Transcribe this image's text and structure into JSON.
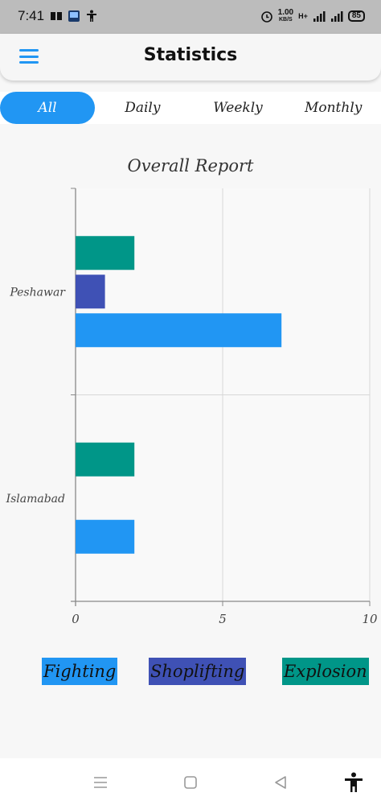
{
  "status_bar": {
    "time": "7:41",
    "net_speed_value": "1.00",
    "net_speed_unit": "KB/S",
    "network_type": "H+",
    "battery": "85"
  },
  "app_bar": {
    "title": "Statistics"
  },
  "tabs": [
    {
      "label": "All",
      "active": true
    },
    {
      "label": "Daily",
      "active": false
    },
    {
      "label": "Weekly",
      "active": false
    },
    {
      "label": "Monthly",
      "active": false
    }
  ],
  "chart_data": {
    "type": "bar",
    "orientation": "horizontal",
    "title": "Overall Report",
    "categories": [
      "Peshawar",
      "Islamabad"
    ],
    "series": [
      {
        "name": "Fighting",
        "color": "#2196f3",
        "values": [
          7,
          2
        ]
      },
      {
        "name": "Shoplifting",
        "color": "#3f51b5",
        "values": [
          1,
          0
        ]
      },
      {
        "name": "Explosion",
        "color": "#009688",
        "values": [
          2,
          2
        ]
      }
    ],
    "xlim": [
      0,
      10
    ],
    "x_ticks": [
      "0",
      "5",
      "10"
    ],
    "grid": true,
    "legend_position": "bottom"
  },
  "nav_bar": {
    "icons": [
      "menu-lines-icon",
      "home-square-icon",
      "back-triangle-icon",
      "accessibility-icon"
    ]
  }
}
